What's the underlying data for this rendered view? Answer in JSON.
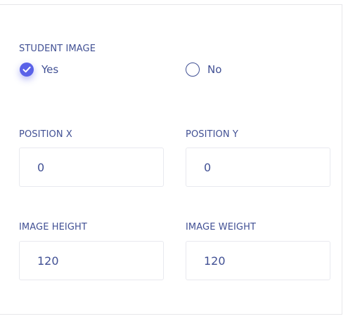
{
  "student_image": {
    "label": "STUDENT IMAGE",
    "options": [
      {
        "label": "Yes",
        "selected": true
      },
      {
        "label": "No",
        "selected": false
      }
    ]
  },
  "fields": {
    "position_x": {
      "label": "POSITION X",
      "value": "0"
    },
    "position_y": {
      "label": "POSITION Y",
      "value": "0"
    },
    "image_height": {
      "label": "IMAGE HEIGHT",
      "value": "120"
    },
    "image_weight": {
      "label": "IMAGE WEIGHT",
      "value": "120"
    }
  },
  "colors": {
    "text": "#415094",
    "accent": "#5a62e8",
    "border": "#e8e9ef"
  }
}
